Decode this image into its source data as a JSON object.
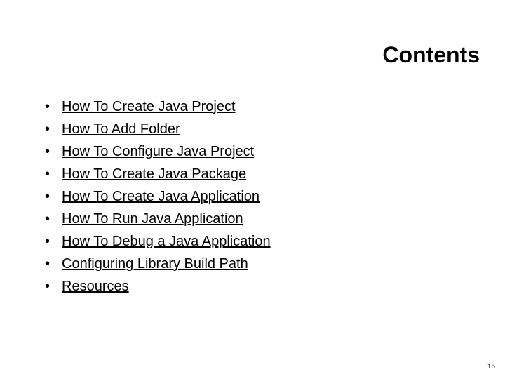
{
  "title": "Contents",
  "items": [
    "How To Create Java Project",
    "How To Add Folder",
    "How To Configure Java Project",
    "How To Create Java Package",
    "How To Create Java Application",
    "How To Run Java Application",
    "How To Debug a Java Application",
    "Configuring Library Build Path",
    "Resources"
  ],
  "pageNumber": "16"
}
